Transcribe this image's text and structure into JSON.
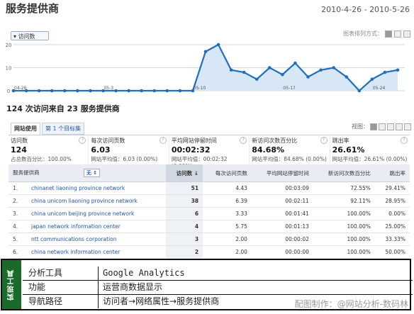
{
  "header": {
    "title": "服务提供商",
    "date_range": "2010-4-26 - 2010-5-26"
  },
  "chart": {
    "metric_button": "访问数",
    "chart_type_label": "图表排列方式：",
    "accent_color": "#1f6fbf",
    "fill_color": "#d7e7f5"
  },
  "chart_data": {
    "type": "area",
    "x": [
      "04-26",
      "04-27",
      "04-28",
      "04-29",
      "04-30",
      "05-01",
      "05-02",
      "05-03",
      "05-04",
      "05-05",
      "05-06",
      "05-07",
      "05-08",
      "05-09",
      "05-10",
      "05-11",
      "05-12",
      "05-13",
      "05-14",
      "05-15",
      "05-16",
      "05-17",
      "05-18",
      "05-19",
      "05-20",
      "05-21",
      "05-22",
      "05-23",
      "05-24",
      "05-25",
      "05-26"
    ],
    "x_tick_labels": [
      "04-26",
      "05-3",
      "05-10",
      "05-17",
      "05-24"
    ],
    "values": [
      0,
      0,
      0,
      0,
      0,
      0,
      0,
      0,
      0,
      0,
      0,
      0,
      0,
      0,
      0,
      17,
      20,
      9,
      8,
      5,
      10,
      7,
      12,
      6,
      9,
      10,
      6,
      0,
      5,
      8,
      9
    ],
    "ylim": [
      0,
      20
    ],
    "y_tick_labels": [
      "0",
      "10",
      "20"
    ]
  },
  "summary": "124 次访问来自 23 服务提供商",
  "tabs": [
    {
      "label": "网站使用",
      "active": true
    },
    {
      "label": "第 1 个目标集",
      "active": false
    }
  ],
  "view_label": "视图：",
  "metrics": [
    {
      "label": "访问数",
      "value": "124",
      "sub": "占总数百分比：100.00%"
    },
    {
      "label": "每次访问页数",
      "value": "6.03",
      "sub": "网站平均值：6.03 (0.00%)"
    },
    {
      "label": "平均网站停留时间",
      "value": "00:02:32",
      "sub": "网站平均值：00:02:32 (0.00%)"
    },
    {
      "label": "新访问次数百分比",
      "value": "84.68%",
      "sub": "网站平均值：84.68% (0.00%)"
    },
    {
      "label": "跳出率",
      "value": "26.61%",
      "sub": "网站平均值：26.61% (0.00%)"
    }
  ],
  "table": {
    "headers": [
      "服务提供商",
      "访问数 ↓",
      "每次访问页数",
      "平均网站停留时间",
      "新访问次数百分比",
      "跳出率"
    ],
    "filter_label": "无",
    "rows": [
      {
        "idx": "1.",
        "name": "chinanet liaoning province network",
        "visits": "51",
        "pages": "4.43",
        "time": "00:03:09",
        "new": "72.55%",
        "bounce": "29.41%"
      },
      {
        "idx": "2.",
        "name": "china unicom liaoning province network",
        "visits": "38",
        "pages": "6.39",
        "time": "00:02:11",
        "new": "92.11%",
        "bounce": "28.95%"
      },
      {
        "idx": "3.",
        "name": "china unicom beijing province network",
        "visits": "6",
        "pages": "3.33",
        "time": "00:01:41",
        "new": "100.00%",
        "bounce": "0.00%"
      },
      {
        "idx": "4.",
        "name": "japan network information center",
        "visits": "4",
        "pages": "5.75",
        "time": "00:01:13",
        "new": "100.00%",
        "bounce": "25.00%"
      },
      {
        "idx": "5.",
        "name": "ntt communications corporation",
        "visits": "3",
        "pages": "2.00",
        "time": "00:00:02",
        "new": "100.00%",
        "bounce": "33.33%"
      },
      {
        "idx": "6.",
        "name": "china network information center",
        "visits": "2",
        "pages": "2.00",
        "time": "00:00:00",
        "new": "100.00%",
        "bounce": "50.00%"
      }
    ]
  },
  "info_box": {
    "band": "实现工具",
    "rows": [
      {
        "key": "分析工具",
        "value": "Google Analytics"
      },
      {
        "key": "功能",
        "value": "运营商数据显示"
      },
      {
        "key": "导航路径",
        "value": "访问者→网络属性→服务提供商"
      }
    ],
    "band_color": "#1a6a2a"
  },
  "watermark": "配图制作：@网站分析-数码林"
}
